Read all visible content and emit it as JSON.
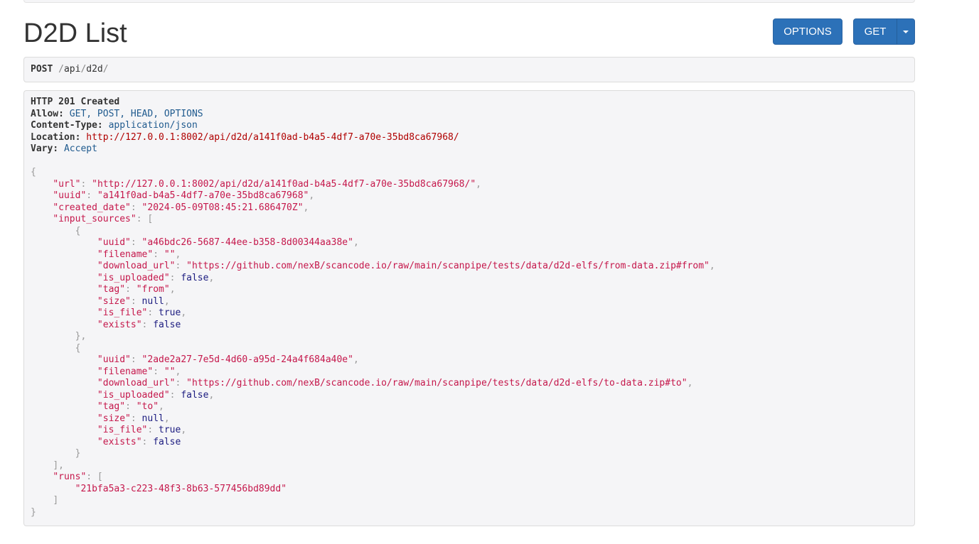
{
  "page": {
    "title": "D2D List"
  },
  "buttons": {
    "options_label": "OPTIONS",
    "get_label": "GET"
  },
  "request": {
    "method": "POST",
    "path_segments": [
      "api",
      "d2d"
    ]
  },
  "response": {
    "status": "HTTP 201 Created",
    "headers": [
      {
        "key": "Allow:",
        "value": "GET, POST, HEAD, OPTIONS",
        "type": "text"
      },
      {
        "key": "Content-Type:",
        "value": "application/json",
        "type": "text"
      },
      {
        "key": "Location:",
        "value": "http://127.0.0.1:8002/api/d2d/a141f0ad-b4a5-4df7-a70e-35bd8ca67968/",
        "type": "link"
      },
      {
        "key": "Vary:",
        "value": "Accept",
        "type": "text"
      }
    ],
    "body": {
      "url": "http://127.0.0.1:8002/api/d2d/a141f0ad-b4a5-4df7-a70e-35bd8ca67968/",
      "uuid": "a141f0ad-b4a5-4df7-a70e-35bd8ca67968",
      "created_date": "2024-05-09T08:45:21.686470Z",
      "input_sources": [
        {
          "uuid": "a46bdc26-5687-44ee-b358-8d00344aa38e",
          "filename": "",
          "download_url": "https://github.com/nexB/scancode.io/raw/main/scanpipe/tests/data/d2d-elfs/from-data.zip#from",
          "is_uploaded": "false",
          "tag": "from",
          "size": "null",
          "is_file": "true",
          "exists": "false"
        },
        {
          "uuid": "2ade2a27-7e5d-4d60-a95d-24a4f684a40e",
          "filename": "",
          "download_url": "https://github.com/nexB/scancode.io/raw/main/scanpipe/tests/data/d2d-elfs/to-data.zip#to",
          "is_uploaded": "false",
          "tag": "to",
          "size": "null",
          "is_file": "true",
          "exists": "false"
        }
      ],
      "runs": [
        "21bfa5a3-c223-48f3-8b63-577456bd89dd"
      ]
    }
  }
}
